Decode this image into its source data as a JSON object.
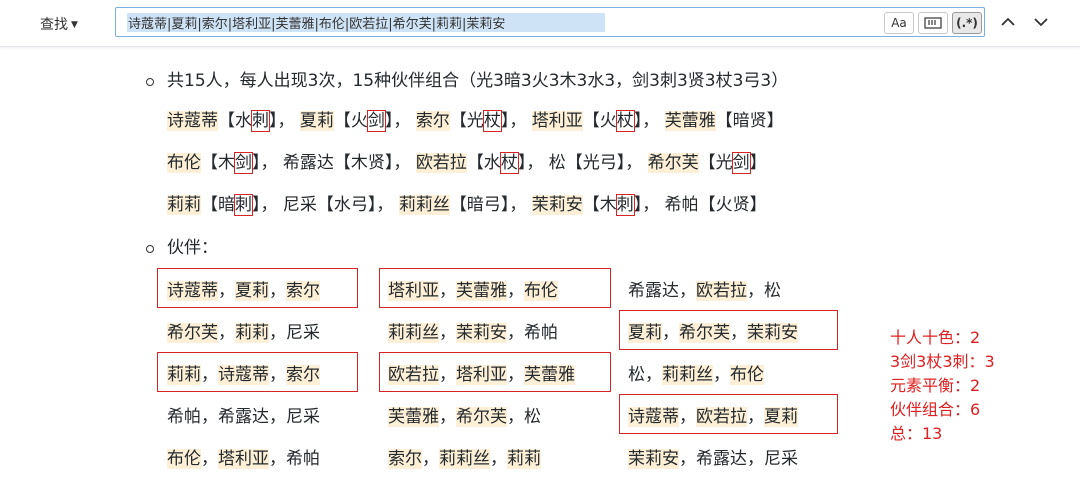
{
  "findbar": {
    "mode_label": "查找",
    "query": "诗蔻蒂|夏莉|索尔|塔利亚|芙蕾雅|布伦|欧若拉|希尔芙|莉莉|茉莉安",
    "opt_case": "Aa",
    "opt_regex": "(.*)"
  },
  "doc": {
    "bullet1_text": "共15人，每人出现3次，15种伙伴组合（光3暗3火3木3水3，剑3刺3贤3杖3弓3）",
    "bullet2_text": "伙伴：",
    "roster_lines": [
      [
        {
          "name": "诗蔻蒂",
          "attr": "【水",
          "weapon": "刺",
          "close": "】",
          "hl": true,
          "box": true
        },
        {
          "name": "夏莉",
          "attr": "【火",
          "weapon": "剑",
          "close": "】",
          "hl": true,
          "box": true
        },
        {
          "name": "索尔",
          "attr": "【光",
          "weapon": "杖",
          "close": "】",
          "hl": true,
          "box": true
        },
        {
          "name": "塔利亚",
          "attr": "【火",
          "weapon": "杖",
          "close": "】",
          "hl": true,
          "box": true
        },
        {
          "name": "芙蕾雅",
          "attr": "【暗贤",
          "weapon": "",
          "close": "】",
          "hl": true,
          "box": false
        }
      ],
      [
        {
          "name": "布伦",
          "attr": "【木",
          "weapon": "剑",
          "close": "】",
          "hl": true,
          "box": true
        },
        {
          "name": "希露达",
          "attr": "【木贤",
          "weapon": "",
          "close": "】",
          "hl": false,
          "box": false
        },
        {
          "name": "欧若拉",
          "attr": "【水",
          "weapon": "杖",
          "close": "】",
          "hl": true,
          "box": true
        },
        {
          "name": "松",
          "attr": "【光弓",
          "weapon": "",
          "close": "】",
          "hl": false,
          "box": false
        },
        {
          "name": "希尔芙",
          "attr": "【光",
          "weapon": "剑",
          "close": "】",
          "hl": true,
          "box": true
        }
      ],
      [
        {
          "name": "莉莉",
          "attr": "【暗",
          "weapon": "刺",
          "close": "】",
          "hl": true,
          "box": true
        },
        {
          "name": "尼采",
          "attr": "【水弓",
          "weapon": "",
          "close": "】",
          "hl": false,
          "box": false
        },
        {
          "name": "莉莉丝",
          "attr": "【暗弓",
          "weapon": "",
          "close": "】",
          "hl": true,
          "box": false
        },
        {
          "name": "茉莉安",
          "attr": "【木",
          "weapon": "刺",
          "close": "】",
          "hl": true,
          "box": true
        },
        {
          "name": "希帕",
          "attr": "【火贤",
          "weapon": "",
          "close": "】",
          "hl": false,
          "box": false
        }
      ]
    ],
    "partner_grid": [
      [
        [
          [
            "诗蔻蒂",
            true
          ],
          [
            "夏莉",
            true
          ],
          [
            "索尔",
            true
          ]
        ],
        [
          [
            "塔利亚",
            true
          ],
          [
            "芙蕾雅",
            true
          ],
          [
            "布伦",
            true
          ]
        ],
        [
          [
            "希露达",
            false
          ],
          [
            "欧若拉",
            true
          ],
          [
            "松",
            false
          ]
        ]
      ],
      [
        [
          [
            "希尔芙",
            true
          ],
          [
            "莉莉",
            true
          ],
          [
            "尼采",
            false
          ]
        ],
        [
          [
            "莉莉丝",
            true
          ],
          [
            "茉莉安",
            true
          ],
          [
            "希帕",
            false
          ]
        ],
        [
          [
            "夏莉",
            true
          ],
          [
            "希尔芙",
            true
          ],
          [
            "茉莉安",
            true
          ]
        ]
      ],
      [
        [
          [
            "莉莉",
            true
          ],
          [
            "诗蔻蒂",
            true
          ],
          [
            "索尔",
            true
          ]
        ],
        [
          [
            "欧若拉",
            true
          ],
          [
            "塔利亚",
            true
          ],
          [
            "芙蕾雅",
            true
          ]
        ],
        [
          [
            "松",
            false
          ],
          [
            "莉莉丝",
            true
          ],
          [
            "布伦",
            true
          ]
        ]
      ],
      [
        [
          [
            "希帕",
            false
          ],
          [
            "希露达",
            false
          ],
          [
            "尼采",
            false
          ]
        ],
        [
          [
            "芙蕾雅",
            true
          ],
          [
            "希尔芙",
            true
          ],
          [
            "松",
            false
          ]
        ],
        [
          [
            "诗蔻蒂",
            true
          ],
          [
            "欧若拉",
            true
          ],
          [
            "夏莉",
            true
          ]
        ]
      ],
      [
        [
          [
            "布伦",
            true
          ],
          [
            "塔利亚",
            true
          ],
          [
            "希帕",
            false
          ]
        ],
        [
          [
            "索尔",
            true
          ],
          [
            "莉莉丝",
            true
          ],
          [
            "莉莉",
            true
          ]
        ],
        [
          [
            "茉莉安",
            true
          ],
          [
            "希露达",
            false
          ],
          [
            "尼采",
            false
          ]
        ]
      ]
    ],
    "boxed_cells": [
      [
        0,
        0
      ],
      [
        0,
        1
      ],
      [
        1,
        2
      ],
      [
        2,
        0
      ],
      [
        2,
        1
      ],
      [
        3,
        2
      ]
    ],
    "summary": [
      "十人十色：2",
      "3剑3杖3刺：3",
      "元素平衡：2",
      "伙伴组合：6",
      "总：13"
    ]
  },
  "colors": {
    "accent_red": "#d62323",
    "highlight": "#fdf0d6",
    "input_border": "#7ab0e0"
  }
}
